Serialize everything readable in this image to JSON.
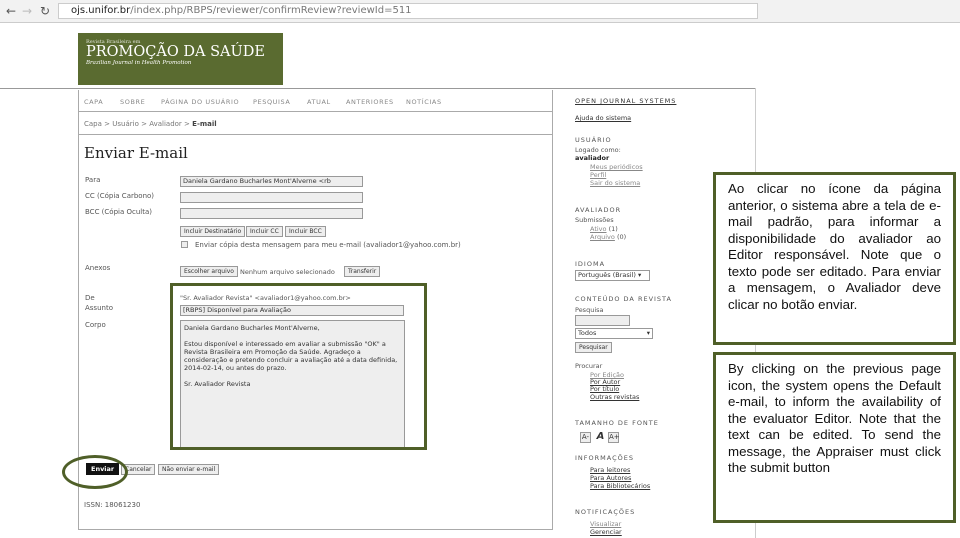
{
  "browser": {
    "url_host": "ojs.unifor.br",
    "url_path": "/index.php/RBPS/reviewer/confirmReview?reviewId=511"
  },
  "logo": {
    "small": "Revista Brasileira em",
    "title": "PROMOÇÃO DA SAÚDE",
    "subtitle": "Brazilian Journal in Health Promotion"
  },
  "nav": [
    "CAPA",
    "SOBRE",
    "PÁGINA DO USUÁRIO",
    "PESQUISA",
    "ATUAL",
    "ANTERIORES",
    "NOTÍCIAS"
  ],
  "breadcrumb": {
    "items": [
      "Capa",
      "Usuário",
      "Avaliador"
    ],
    "current": "E-mail",
    "sep": ">"
  },
  "page_title": "Enviar E-mail",
  "form": {
    "para_label": "Para",
    "para_value": "Daniela Gardano Bucharles Mont'Alverne <rb",
    "cc_label": "CC (Cópia Carbono)",
    "bcc_label": "BCC (Cópia Oculta)",
    "btn_incluir_dest": "Incluir Destinatário",
    "btn_incluir_cc": "Incluir CC",
    "btn_incluir_bcc": "Incluir BCC",
    "copy_label": "Enviar cópia desta mensagem para meu e-mail (avaliador1@yahoo.com.br)",
    "anexos_label": "Anexos",
    "file_button": "Escolher arquivo",
    "file_status": "Nenhum arquivo selecionado",
    "transfer": "Transferir",
    "de_label": "De",
    "de_value": "\"Sr. Avaliador Revista\" <avaliador1@yahoo.com.br>",
    "assunto_label": "Assunto",
    "assunto_value": "[RBPS] Disponível para Avaliação",
    "corpo_label": "Corpo",
    "corpo_value": "Daniela Gardano Bucharles Mont'Alverne,\n\nEstou disponível e interessado em avaliar a submissão \"OK\" a\nRevista Brasileira em Promoção da Saúde. Agradeço a\nconsideração e pretendo concluir a avaliação até a data definida,\n2014-02-14, ou antes do prazo.\n\nSr. Avaliador Revista",
    "enviar": "Enviar",
    "cancelar": "Cancelar",
    "nao_enviar": "Não enviar e-mail"
  },
  "issn": "ISSN: 18061230",
  "sidebar": {
    "ojs": "OPEN JOURNAL SYSTEMS",
    "ajuda": "Ajuda do sistema",
    "usuario_h": "USUÁRIO",
    "logado": "Logado como:",
    "user": "avaliador",
    "user_links": [
      "Meus periódicos",
      "Perfil",
      "Sair do sistema"
    ],
    "avaliador_h": "AVALIADOR",
    "submissoes": "Submissões",
    "ativo": "Ativo",
    "ativo_count": "(1)",
    "arquivo": "Arquivo",
    "arquivo_count": "(0)",
    "idioma_h": "IDIOMA",
    "idioma_value": "Português (Brasil)",
    "conteudo_h": "CONTEÚDO DA REVISTA",
    "pesquisa": "Pesquisa",
    "scope": "Todos",
    "pesquisar": "Pesquisar",
    "procurar": "Procurar",
    "procurar_links": [
      "Por Edição",
      "Por Autor",
      "Por título",
      "Outras revistas"
    ],
    "fonte_h": "TAMANHO DE FONTE",
    "font_btns": [
      "A-",
      "A",
      "A+"
    ],
    "info_h": "INFORMAÇÕES",
    "info_links": [
      "Para leitores",
      "Para Autores",
      "Para Bibliotecários"
    ],
    "notif_h": "NOTIFICAÇÕES",
    "notif_links": [
      "Visualizar",
      "Gerenciar"
    ]
  },
  "callouts": {
    "pt": "Ao clicar no ícone da página anterior, o sistema abre a tela de e-mail padrão, para informar a disponibilidade do avaliador ao Editor responsável. Note que o texto pode ser editado. Para enviar a mensagem, o Avaliador deve clicar no botão enviar.",
    "en": "By clicking on the previous page icon, the system opens the Default e-mail, to inform the availability of the evaluator Editor. Note that the text can be edited. To send the message, the Appraiser must click the submit button"
  },
  "colors": {
    "accent": "#4f5f28",
    "logo_bg": "#5a6b30"
  }
}
